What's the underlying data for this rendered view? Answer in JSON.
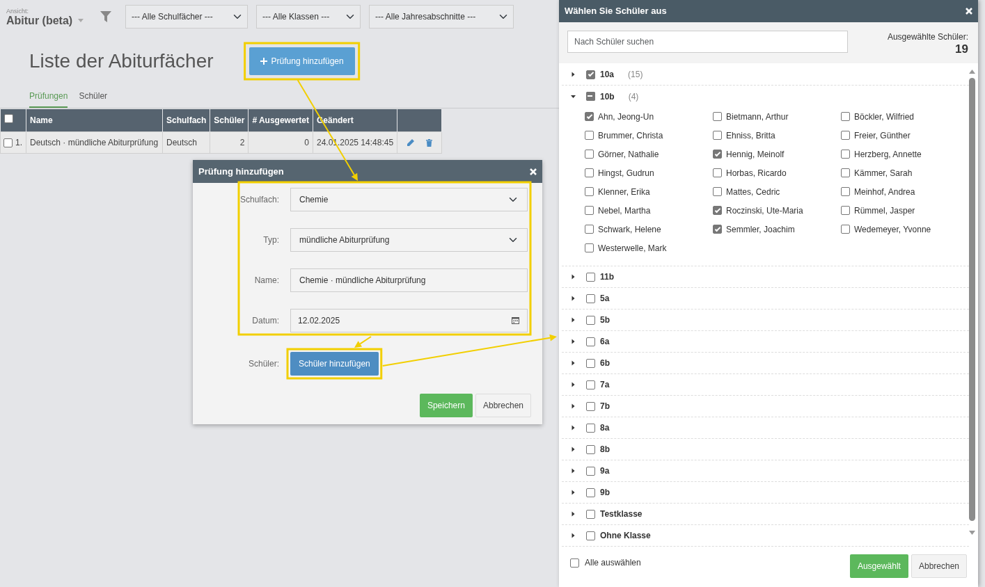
{
  "view": {
    "label": "Ansicht:",
    "title": "Abitur (beta)"
  },
  "filters": [
    "--- Alle Schulfächer ---",
    "--- Alle Klassen ---",
    "--- Alle Jahresabschnitte ---"
  ],
  "page_title": "Liste der Abiturfächer",
  "add_button": "Prüfung hinzufügen",
  "tabs": [
    {
      "label": "Prüfungen",
      "selected": true
    },
    {
      "label": "Schüler",
      "selected": false
    }
  ],
  "table": {
    "all_checked": false,
    "columns": [
      "Name",
      "Schulfach",
      "Schüler",
      "# Ausgewertet",
      "Geändert"
    ],
    "rows": [
      {
        "checked": false,
        "index": "1.",
        "cells": [
          "Deutsch · mündliche Abiturprüfung",
          "Deutsch",
          "2",
          "0",
          "24.01.2025 14:48:45"
        ]
      }
    ]
  },
  "modal": {
    "title": "Prüfung hinzufügen",
    "fields": [
      {
        "label": "Schulfach:",
        "kind": "select",
        "value": "Chemie"
      },
      {
        "label": "Typ:",
        "kind": "select",
        "value": "mündliche Abiturprüfung"
      },
      {
        "label": "Name:",
        "kind": "text",
        "value": "Chemie · mündliche Abiturprüfung"
      },
      {
        "label": "Datum:",
        "kind": "date",
        "value": "12.02.2025"
      }
    ],
    "students_label": "Schüler:",
    "students_button": "Schüler hinzufügen",
    "buttons": [
      {
        "label": "Speichern",
        "kind": "primary"
      },
      {
        "label": "Abbrechen",
        "kind": "secondary"
      }
    ]
  },
  "student_picker": {
    "title": "Wählen Sie Schüler aus",
    "search": {
      "placeholder": "Nach Schüler suchen"
    },
    "selected_label": "Ausgewählte Schüler:",
    "selected_count": "19",
    "classes": [
      {
        "name": "10a",
        "count": "(15)",
        "checked": true,
        "indeterminate": false,
        "expanded": false
      },
      {
        "name": "10b",
        "count": "(4)",
        "checked": false,
        "indeterminate": true,
        "expanded": true,
        "children": [
          {
            "name": "Ahn, Jeong-Un",
            "checked": true
          },
          {
            "name": "Bietmann, Arthur",
            "checked": false
          },
          {
            "name": "Böckler, Wilfried",
            "checked": false
          },
          {
            "name": "Brummer, Christa",
            "checked": false
          },
          {
            "name": "Ehniss, Britta",
            "checked": false
          },
          {
            "name": "Freier, Günther",
            "checked": false
          },
          {
            "name": "Görner, Nathalie",
            "checked": false
          },
          {
            "name": "Hennig, Meinolf",
            "checked": true
          },
          {
            "name": "Herzberg, Annette",
            "checked": false
          },
          {
            "name": "Hingst, Gudrun",
            "checked": false
          },
          {
            "name": "Horbas, Ricardo",
            "checked": false
          },
          {
            "name": "Kämmer, Sarah",
            "checked": false
          },
          {
            "name": "Klenner, Erika",
            "checked": false
          },
          {
            "name": "Mattes, Cedric",
            "checked": false
          },
          {
            "name": "Meinhof, Andrea",
            "checked": false
          },
          {
            "name": "Nebel, Martha",
            "checked": false
          },
          {
            "name": "Roczinski, Ute-Maria",
            "checked": true
          },
          {
            "name": "Rümmel, Jasper",
            "checked": false
          },
          {
            "name": "Schwark, Helene",
            "checked": false
          },
          {
            "name": "Semmler, Joachim",
            "checked": true
          },
          {
            "name": "Wedemeyer, Yvonne",
            "checked": false
          },
          {
            "name": "Westerwelle, Mark",
            "checked": false
          }
        ]
      },
      {
        "name": "11b",
        "checked": false,
        "indeterminate": false,
        "expanded": false
      },
      {
        "name": "5a",
        "checked": false,
        "indeterminate": false,
        "expanded": false
      },
      {
        "name": "5b",
        "checked": false,
        "indeterminate": false,
        "expanded": false
      },
      {
        "name": "6a",
        "checked": false,
        "indeterminate": false,
        "expanded": false
      },
      {
        "name": "6b",
        "checked": false,
        "indeterminate": false,
        "expanded": false
      },
      {
        "name": "7a",
        "checked": false,
        "indeterminate": false,
        "expanded": false
      },
      {
        "name": "7b",
        "checked": false,
        "indeterminate": false,
        "expanded": false
      },
      {
        "name": "8a",
        "checked": false,
        "indeterminate": false,
        "expanded": false
      },
      {
        "name": "8b",
        "checked": false,
        "indeterminate": false,
        "expanded": false
      },
      {
        "name": "9a",
        "checked": false,
        "indeterminate": false,
        "expanded": false
      },
      {
        "name": "9b",
        "checked": false,
        "indeterminate": false,
        "expanded": false
      },
      {
        "name": "Testklasse",
        "checked": false,
        "indeterminate": false,
        "expanded": false
      },
      {
        "name": "Ohne Klasse",
        "checked": false,
        "indeterminate": false,
        "expanded": false
      }
    ],
    "select_all": {
      "label": "Alle auswählen",
      "checked": false
    },
    "buttons": [
      {
        "label": "Ausgewählt",
        "kind": "primary"
      },
      {
        "label": "Abbrechen",
        "kind": "secondary"
      }
    ]
  }
}
